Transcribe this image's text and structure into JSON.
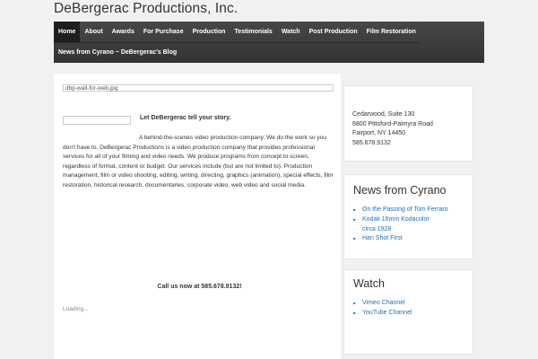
{
  "site": {
    "title": "DeBergerac Productions, Inc."
  },
  "nav": {
    "row1": [
      "Home",
      "About",
      "Awards",
      "For Purchase",
      "Production",
      "Testimonials",
      "Watch",
      "Post Production",
      "Film Restoration"
    ],
    "row2": [
      "News from Cyrano ~ DeBergerac's Blog"
    ]
  },
  "main": {
    "image_alt": "dbp-wall-for-web.jpg",
    "tagline": "Let DeBergerac tell your story.",
    "body": "A behind-the-scenes video production company. We do the work so you don't have to. DeBergerac Productions is a video production company that provides professional services for all of your filming and video needs. We produce programs from concept to screen, regardless of format, content or budget. Our services include (but are not limited to): Production management, film or video shooting, editing, writing, directing, graphics (animation), special effects, film restoration, historical research, documentaries, corporate video, web video and social media.",
    "call": "Call us now at 585.678.9132!",
    "loading": "Loading..."
  },
  "address": {
    "line1": "Cedarwood, Suite 130",
    "line2": "6800 Pittsford-Palmyra Road",
    "line3": "Fairport, NY 14450",
    "line4": "585.678.9132"
  },
  "news": {
    "title": "News from Cyrano",
    "items": [
      "On the Passing of Tom Ferraro",
      "Kodak 16mm Kodacolor circa 1928",
      "Han Shot First"
    ]
  },
  "watch": {
    "title": "Watch",
    "items": [
      "Vimeo Channel",
      "YouTube Channel"
    ]
  }
}
